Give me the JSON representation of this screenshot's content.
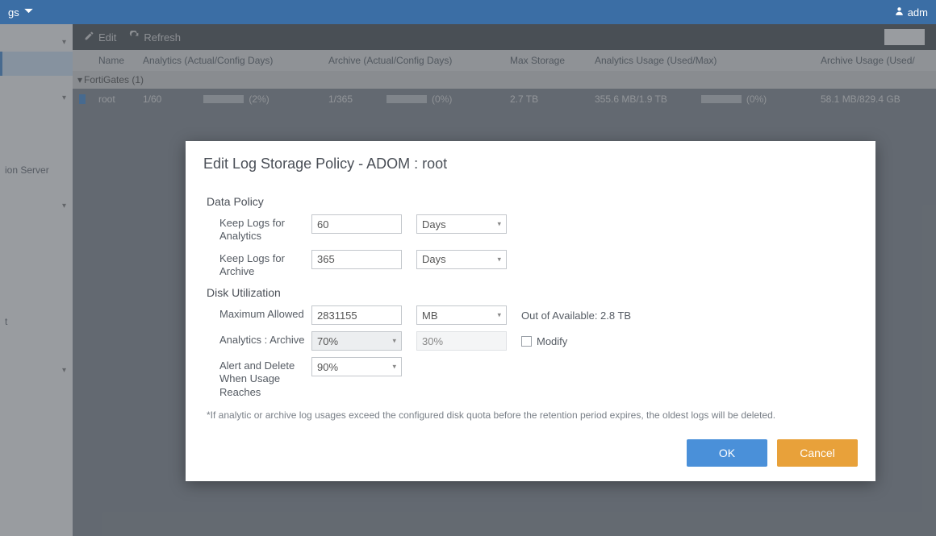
{
  "topbar": {
    "menu_label": "gs",
    "user_label": "adm"
  },
  "sidebar": {
    "items": [
      {
        "label": ""
      },
      {
        "label": ""
      },
      {
        "label": "ion Server"
      },
      {
        "label": ""
      },
      {
        "label": ""
      },
      {
        "label": "t"
      },
      {
        "label": ""
      }
    ]
  },
  "toolbar": {
    "edit_label": "Edit",
    "refresh_label": "Refresh"
  },
  "table": {
    "headers": {
      "name": "Name",
      "analytics": "Analytics (Actual/Config Days)",
      "archive": "Archive (Actual/Config Days)",
      "max_storage": "Max Storage",
      "analytics_usage": "Analytics Usage (Used/Max)",
      "archive_usage": "Archive Usage (Used/"
    },
    "group_label": "FortiGates (1)",
    "rows": [
      {
        "name": "root",
        "analytics_days": "1/60",
        "analytics_pct": "(2%)",
        "archive_days": "1/365",
        "archive_pct": "(0%)",
        "max_storage": "2.7 TB",
        "analytics_usage": "355.6 MB/1.9 TB",
        "analytics_usage_pct": "(0%)",
        "archive_usage": "58.1 MB/829.4 GB"
      }
    ]
  },
  "modal": {
    "title": "Edit Log Storage Policy - ADOM : root",
    "section_data_policy": "Data Policy",
    "keep_analytics_label": "Keep Logs for Analytics",
    "keep_analytics_value": "60",
    "keep_analytics_unit": "Days",
    "keep_archive_label": "Keep Logs for Archive",
    "keep_archive_value": "365",
    "keep_archive_unit": "Days",
    "section_disk": "Disk Utilization",
    "max_allowed_label": "Maximum Allowed",
    "max_allowed_value": "2831155",
    "max_allowed_unit": "MB",
    "out_of_available": "Out of Available: 2.8 TB",
    "ratio_label": "Analytics : Archive",
    "ratio_analytics": "70%",
    "ratio_archive": "30%",
    "modify_label": "Modify",
    "alert_label": "Alert and Delete When Usage Reaches",
    "alert_value": "90%",
    "note": "*If analytic or archive log usages exceed the configured disk quota before the retention period expires, the oldest logs will be deleted.",
    "ok_label": "OK",
    "cancel_label": "Cancel"
  }
}
